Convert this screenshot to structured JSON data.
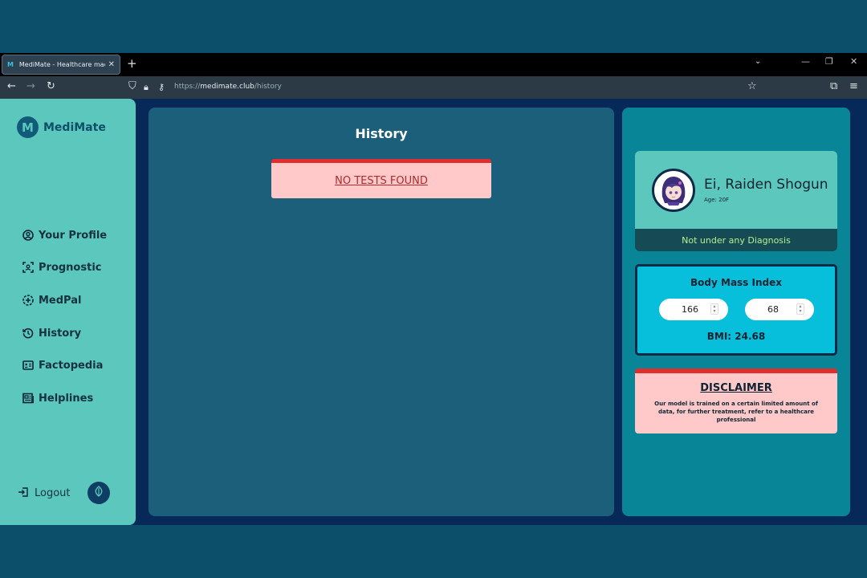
{
  "browser": {
    "tab_title": "MediMate - Healthcare made simple",
    "tab_favicon": "M",
    "url_prefix": "https://",
    "url_domain": "medimate.club",
    "url_path": "/history"
  },
  "sidebar": {
    "brand": "MediMate",
    "items": [
      {
        "label": "Your Profile",
        "icon": "user-circle-icon"
      },
      {
        "label": "Prognostic",
        "icon": "scan-icon"
      },
      {
        "label": "MedPal",
        "icon": "medical-badge-icon"
      },
      {
        "label": "History",
        "icon": "history-icon"
      },
      {
        "label": "Factopedia",
        "icon": "id-card-icon"
      },
      {
        "label": "Helplines",
        "icon": "newspaper-icon"
      }
    ],
    "logout_label": "Logout"
  },
  "main": {
    "title": "History",
    "empty_message": "NO TESTS FOUND"
  },
  "profile": {
    "name": "Ei, Raiden Shogun",
    "age": "Age: 20F",
    "status": "Not under any Diagnosis"
  },
  "bmi": {
    "title": "Body Mass Index",
    "height": "166",
    "weight": "68",
    "result": "BMI: 24.68"
  },
  "disclaimer": {
    "title": "DISCLAIMER",
    "text": "Our model is trained on a certain limited amount of data, for further treatment, refer to a healthcare professional"
  },
  "colors": {
    "sidebar": "#5cc7bc",
    "main_panel": "#1b5f7a",
    "right_panel": "#088596",
    "alert_red": "#e02d2d",
    "alert_bg": "#ffc9c9",
    "bmi_card": "#07bedb"
  }
}
